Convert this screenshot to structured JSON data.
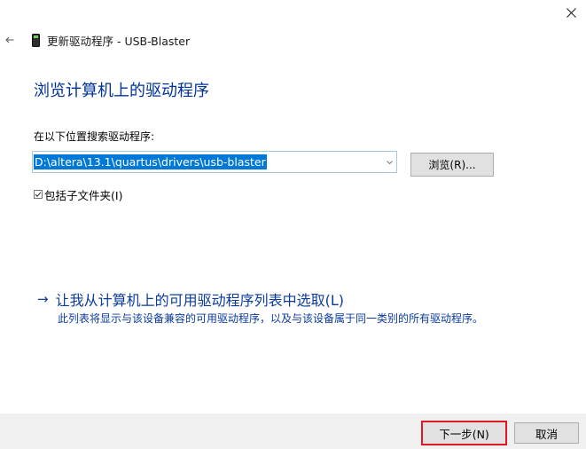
{
  "window": {
    "title": "更新驱动程序 - USB-Blaster",
    "icons": {
      "close": "close-icon",
      "back": "back-arrow-icon",
      "device": "usb-device-icon"
    }
  },
  "page": {
    "heading": "浏览计算机上的驱动程序",
    "search_label": "在以下位置搜索驱动程序:",
    "path_value": "D:\\altera\\13.1\\quartus\\drivers\\usb-blaster",
    "browse_label": "浏览(R)...",
    "include_subfolders_label": "包括子文件夹(I)",
    "include_subfolders_checked": true
  },
  "pick": {
    "arrow": "→",
    "link": "让我从计算机上的可用驱动程序列表中选取(L)",
    "description": "此列表将显示与该设备兼容的可用驱动程序，以及与该设备属于同一类别的所有驱动程序。"
  },
  "footer": {
    "next_label": "下一步(N)",
    "cancel_label": "取消"
  },
  "colors": {
    "heading": "#003399",
    "link": "#0b3c9c",
    "selection": "#0078d7",
    "highlight_border": "#e01a23",
    "footer_bg": "#f0f0f0"
  }
}
